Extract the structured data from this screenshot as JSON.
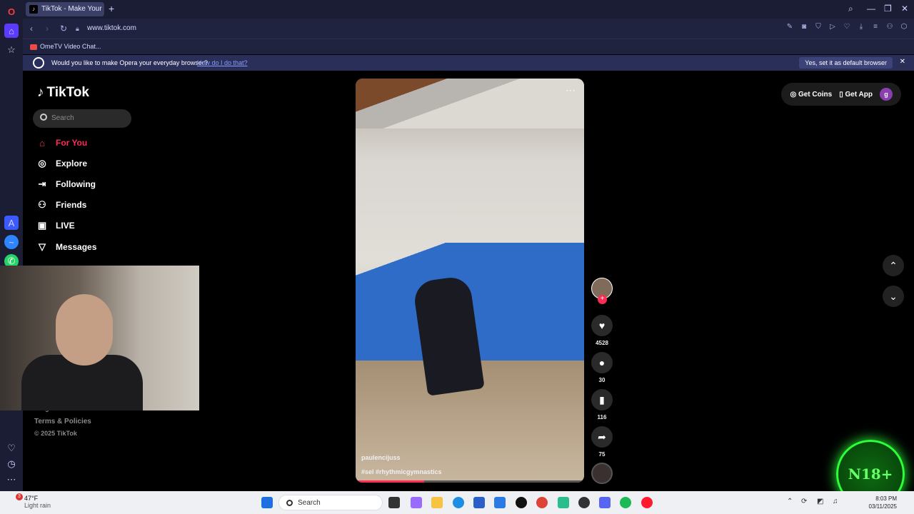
{
  "browser": {
    "tab_title": "TikTok - Make Your D",
    "url": "www.tiktok.com",
    "bookmark": "OmeTV Video Chat...",
    "notice_message": "Would you like to make Opera your everyday browser?",
    "notice_link": "How do I do that?",
    "notice_accept": "Yes, set it as default browser"
  },
  "tiktok": {
    "logo_text": "TikTok",
    "search_placeholder": "Search",
    "menu": [
      {
        "label": "For You",
        "icon": "home-icon"
      },
      {
        "label": "Explore",
        "icon": "compass-icon"
      },
      {
        "label": "Following",
        "icon": "following-icon"
      },
      {
        "label": "Friends",
        "icon": "friends-icon"
      },
      {
        "label": "LIVE",
        "icon": "live-icon"
      },
      {
        "label": "Messages",
        "icon": "messages-icon"
      }
    ],
    "footer": {
      "program": "Program",
      "terms": "Terms & Policies",
      "copyright": "© 2025 TikTok"
    },
    "top_right": {
      "coins": "Get Coins",
      "app": "Get App",
      "avatar_letter": "g"
    },
    "video": {
      "author": "paulencijuss",
      "tags": "#sel #rhythmicgymnastics",
      "likes": "4528",
      "comments": "30",
      "saves": "116",
      "shares": "75",
      "progress": 0.3
    }
  },
  "overlay": {
    "badge": "N18+"
  },
  "taskbar": {
    "temperature": "47°F",
    "weather": "Light rain",
    "weather_badge": "3",
    "search": "Search",
    "time": "8:03 PM",
    "date": "03/11/2025"
  },
  "colors": {
    "tiktok_accent": "#fe2c55",
    "opera_bg": "#1a1d33",
    "n18_green": "#2cff3a"
  }
}
